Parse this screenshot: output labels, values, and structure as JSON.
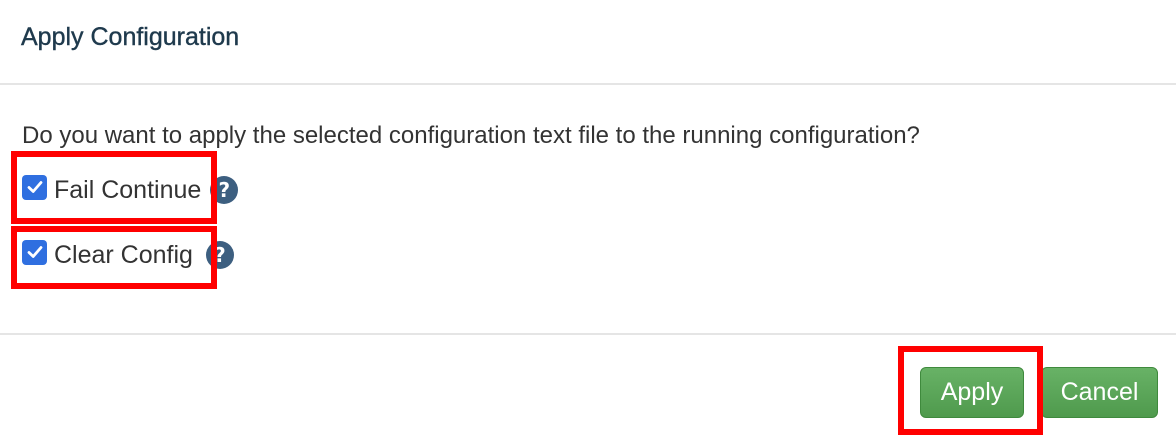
{
  "dialog": {
    "title": "Apply Configuration",
    "question": "Do you want to apply the selected configuration text file to the running configuration?",
    "options": [
      {
        "label": "Fail Continue",
        "checked": true,
        "help_icon": "question-circle-icon"
      },
      {
        "label": "Clear Config",
        "checked": true,
        "help_icon": "question-circle-icon"
      }
    ],
    "help_glyph": "?",
    "buttons": {
      "apply_label": "Apply",
      "cancel_label": "Cancel"
    }
  },
  "colors": {
    "title": "#1f3a4d",
    "checkbox": "#2f6fe0",
    "help_icon": "#3d5f80",
    "button_green": "#5ca65a",
    "highlight": "#ff0000"
  }
}
